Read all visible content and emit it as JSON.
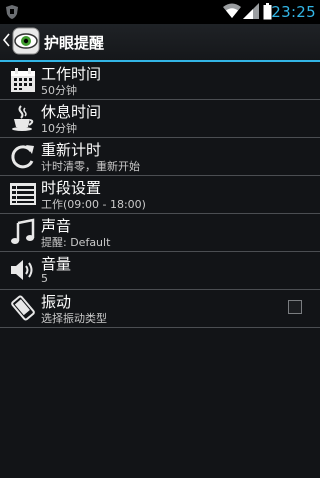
{
  "status_bar": {
    "time": "23:25"
  },
  "action_bar": {
    "title": "护眼提醒"
  },
  "settings": [
    {
      "title": "工作时间",
      "subtitle": "50分钟",
      "icon": "calendar-icon"
    },
    {
      "title": "休息时间",
      "subtitle": "10分钟",
      "icon": "coffee-icon"
    },
    {
      "title": "重新计时",
      "subtitle": "计时清零，重新开始",
      "icon": "refresh-icon"
    },
    {
      "title": "时段设置",
      "subtitle": "工作(09:00 - 18:00)",
      "icon": "list-icon"
    },
    {
      "title": "声音",
      "subtitle": "提醒: Default",
      "icon": "music-note-icon"
    },
    {
      "title": "音量",
      "subtitle": "5",
      "icon": "speaker-icon"
    },
    {
      "title": "振动",
      "subtitle": "选择振动类型",
      "icon": "vibrate-icon",
      "checked": false
    }
  ],
  "colors": {
    "accent": "#33b5e5",
    "background": "#121417",
    "divider": "#4b4e52"
  }
}
